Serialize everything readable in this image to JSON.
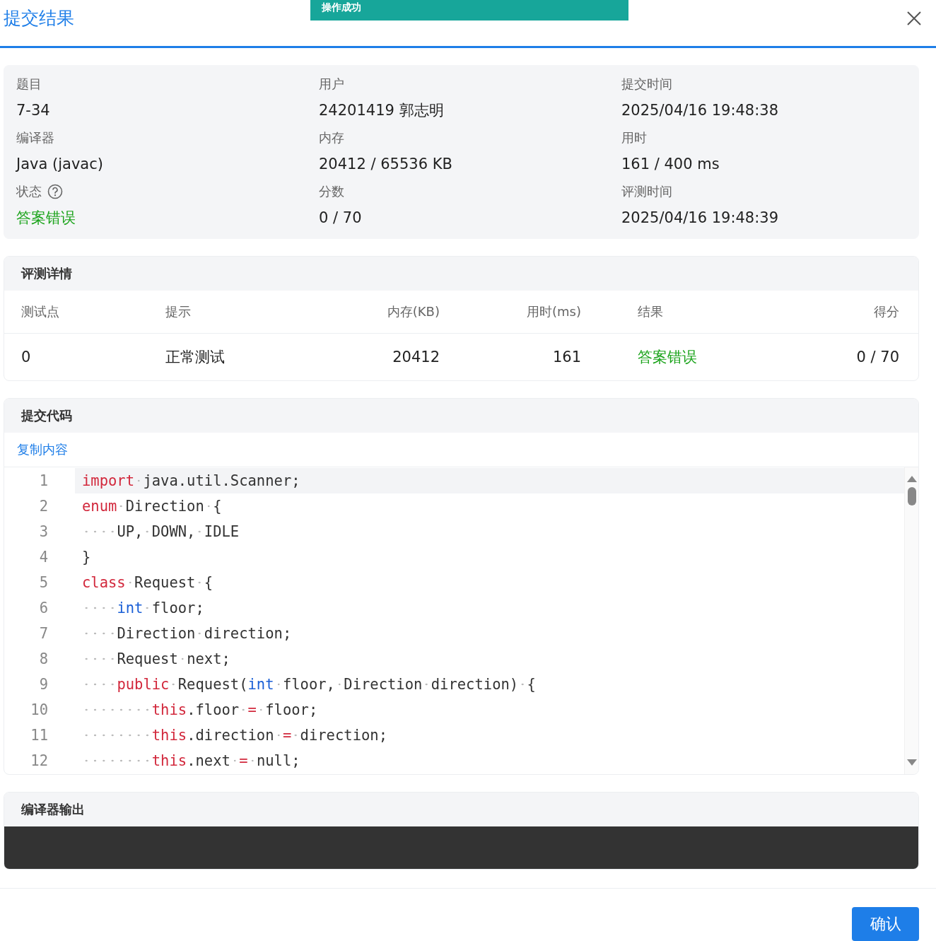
{
  "toast": {
    "text": "操作成功"
  },
  "dialog": {
    "title": "提交结果"
  },
  "info": [
    {
      "label": "题目",
      "value": "7-34",
      "kind": "plain"
    },
    {
      "label": "用户",
      "value": "24201419 郭志明",
      "kind": "plain"
    },
    {
      "label": "提交时间",
      "value": "2025/04/16 19:48:38",
      "kind": "plain"
    },
    {
      "label": "编译器",
      "value": "Java (javac)",
      "kind": "plain"
    },
    {
      "label": "内存",
      "value": "20412 / 65536 KB",
      "kind": "plain"
    },
    {
      "label": "用时",
      "value": "161 / 400 ms",
      "kind": "plain"
    },
    {
      "label": "状态",
      "value": "答案错误",
      "kind": "status",
      "color": "#1aa31a"
    },
    {
      "label": "分数",
      "value": "0 / 70",
      "kind": "plain"
    },
    {
      "label": "评测时间",
      "value": "2025/04/16 19:48:39",
      "kind": "plain"
    }
  ],
  "judge_details": {
    "title": "评测详情",
    "columns": [
      "测试点",
      "提示",
      "内存(KB)",
      "用时(ms)",
      "结果",
      "得分"
    ],
    "rows": [
      {
        "cells": [
          "0",
          "正常测试",
          "20412",
          "161",
          "答案错误",
          "0 / 70"
        ]
      }
    ]
  },
  "submitted_code": {
    "title": "提交代码",
    "copy_link": "复制内容",
    "lines": [
      {
        "number": "1",
        "highlighted": true,
        "tokens": [
          {
            "kind": "keyword",
            "text": "import"
          },
          {
            "kind": "plain",
            "text": " java.util.Scanner;"
          }
        ]
      },
      {
        "number": "2",
        "highlighted": false,
        "tokens": [
          {
            "kind": "keyword",
            "text": "enum"
          },
          {
            "kind": "plain",
            "text": " Direction {"
          }
        ]
      },
      {
        "number": "3",
        "highlighted": false,
        "tokens": [
          {
            "kind": "plain",
            "text": "    UP, DOWN, IDLE"
          }
        ]
      },
      {
        "number": "4",
        "highlighted": false,
        "tokens": [
          {
            "kind": "plain",
            "text": "}"
          }
        ]
      },
      {
        "number": "5",
        "highlighted": false,
        "tokens": [
          {
            "kind": "keyword",
            "text": "class"
          },
          {
            "kind": "plain",
            "text": " Request {"
          }
        ]
      },
      {
        "number": "6",
        "highlighted": false,
        "tokens": [
          {
            "kind": "type",
            "text": "    int"
          },
          {
            "kind": "plain",
            "text": " floor;"
          }
        ]
      },
      {
        "number": "7",
        "highlighted": false,
        "tokens": [
          {
            "kind": "plain",
            "text": "    Direction direction;"
          }
        ]
      },
      {
        "number": "8",
        "highlighted": false,
        "tokens": [
          {
            "kind": "plain",
            "text": "    Request next;"
          }
        ]
      },
      {
        "number": "9",
        "highlighted": false,
        "tokens": [
          {
            "kind": "keyword",
            "text": "    public"
          },
          {
            "kind": "plain",
            "text": " Request("
          },
          {
            "kind": "type",
            "text": "int"
          },
          {
            "kind": "plain",
            "text": " floor, Direction direction) {"
          }
        ]
      },
      {
        "number": "10",
        "highlighted": false,
        "tokens": [
          {
            "kind": "keyword",
            "text": "        this"
          },
          {
            "kind": "plain",
            "text": ".floor "
          },
          {
            "kind": "keyword",
            "text": "="
          },
          {
            "kind": "plain",
            "text": " floor;"
          }
        ]
      },
      {
        "number": "11",
        "highlighted": false,
        "tokens": [
          {
            "kind": "keyword",
            "text": "        this"
          },
          {
            "kind": "plain",
            "text": ".direction "
          },
          {
            "kind": "keyword",
            "text": "="
          },
          {
            "kind": "plain",
            "text": " direction;"
          }
        ]
      },
      {
        "number": "12",
        "highlighted": false,
        "tokens": [
          {
            "kind": "keyword",
            "text": "        this"
          },
          {
            "kind": "plain",
            "text": ".next "
          },
          {
            "kind": "keyword",
            "text": "="
          },
          {
            "kind": "plain",
            "text": " null;"
          }
        ]
      }
    ]
  },
  "compiler_output": {
    "title": "编译器输出"
  },
  "buttons": [
    "确认"
  ]
}
